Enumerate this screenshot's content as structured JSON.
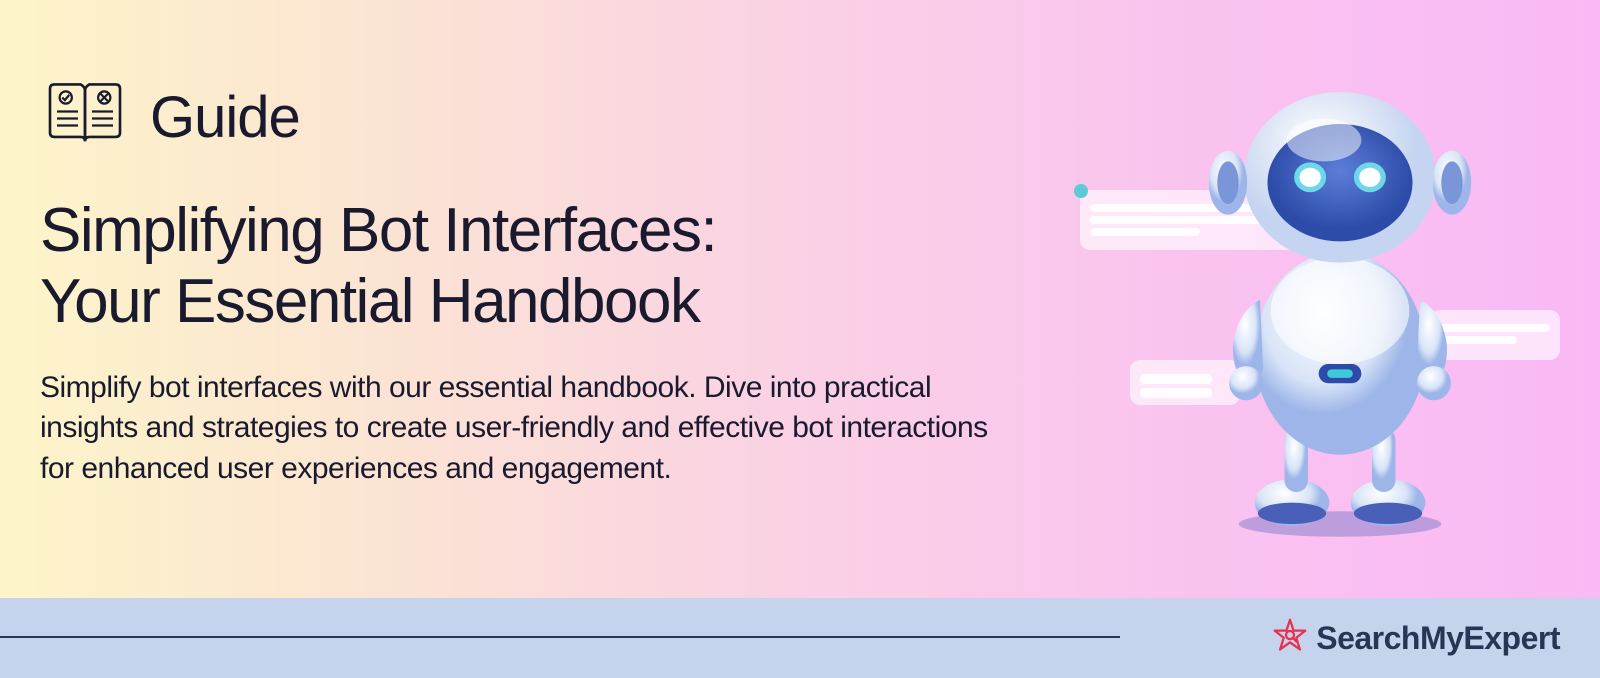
{
  "header": {
    "guide_label": "Guide"
  },
  "main": {
    "title_line1": "Simplifying Bot Interfaces:",
    "title_line2": "Your Essential Handbook",
    "description": "Simplify bot interfaces with our essential handbook. Dive into practical insights and strategies to create user-friendly and effective bot interactions for enhanced user experiences and engagement."
  },
  "footer": {
    "brand_name": "SearchMyExpert"
  }
}
